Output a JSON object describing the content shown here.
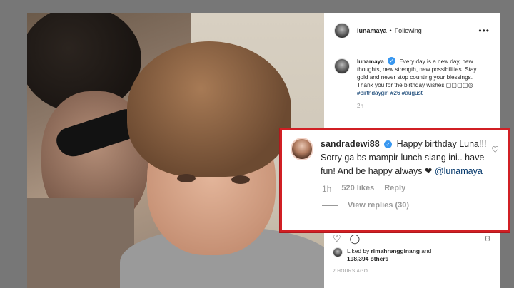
{
  "header": {
    "username": "lunamaya",
    "separator": "•",
    "follow_state": "Following",
    "more_icon": "more-horizontal-icon"
  },
  "caption": {
    "username": "lunamaya",
    "text": "Every day is a new day, new thoughts, new strength, new possibilities. Stay gold and never stop counting your blessings. Thank you for the birthday wishes ▢▢▢▢◎",
    "hashtags": "#birthdaygirl #26 #august",
    "time": "2h"
  },
  "comment": {
    "username": "sandradewi88",
    "text": "Happy birthday Luna!!! Sorry ga bs mampir lunch siang ini.. have fun! And be happy always ❤",
    "mention": "@lunamaya",
    "time": "1h",
    "likes": "520 likes",
    "reply_label": "Reply",
    "view_replies": "View replies (30)"
  },
  "actions": {
    "like_icon": "heart-icon",
    "comment_icon": "comment-icon",
    "bookmark_icon": "bookmark-icon"
  },
  "likes": {
    "prefix": "Liked by",
    "user": "rimahrengginang",
    "conj": "and",
    "others": "198,394 others"
  },
  "post_time": "2 HOURS AGO",
  "colors": {
    "highlight": "#d11f24",
    "verified": "#3897f0",
    "link": "#003569"
  }
}
